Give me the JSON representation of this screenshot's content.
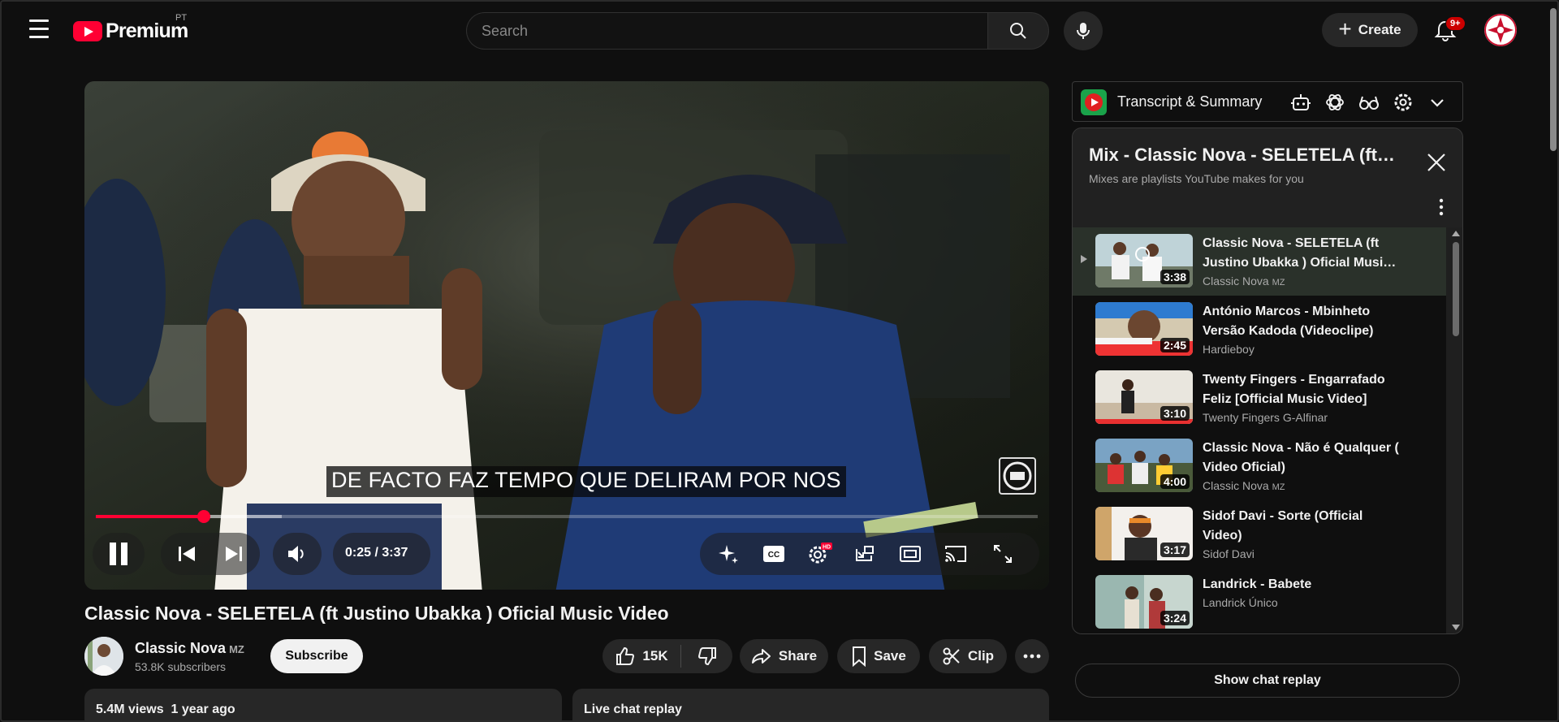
{
  "header": {
    "logo_text": "Premium",
    "country_code": "PT",
    "search_placeholder": "Search",
    "create_label": "Create",
    "notification_count": "9+"
  },
  "player": {
    "subtitle": "DE FACTO FAZ TEMPO QUE DELIRAM POR NOS",
    "current_time": "0:25",
    "separator": " / ",
    "duration": "3:37",
    "progress_fraction": 0.115,
    "buffered_fraction": 0.197
  },
  "video": {
    "title": "Classic Nova - SELETELA (ft Justino Ubakka ) Oficial Music Video",
    "channel": "Classic Nova",
    "channel_badge": "MZ",
    "subscribers": "53.8K subscribers",
    "subscribe_label": "Subscribe",
    "likes": "15K",
    "share_label": "Share",
    "save_label": "Save",
    "clip_label": "Clip"
  },
  "description": {
    "views_date": "5.4M views  1 year ago"
  },
  "live_chat": {
    "label": "Live chat replay"
  },
  "transcript_bar": {
    "title": "Transcript & Summary"
  },
  "mix": {
    "title": "Mix - Classic Nova - SELETELA (ft Justino Ubakka ) Oficial Music Video",
    "subtitle": "Mixes are playlists YouTube makes for you",
    "items": [
      {
        "title": "Classic Nova - SELETELA (ft Justino Ubakka ) Oficial Musi…",
        "channel": "Classic Nova",
        "badge": "MZ",
        "duration": "3:38"
      },
      {
        "title": "António Marcos - Mbinheto Versão Kadoda (Videoclipe)",
        "channel": "Hardieboy",
        "badge": "",
        "duration": "2:45"
      },
      {
        "title": "Twenty Fingers - Engarrafado Feliz [Official Music Video]",
        "channel": "Twenty Fingers G-Alfinar",
        "badge": "",
        "duration": "3:10"
      },
      {
        "title": "Classic Nova - Não é Qualquer ( Video Oficial)",
        "channel": "Classic Nova",
        "badge": "MZ",
        "duration": "4:00"
      },
      {
        "title": "Sidof Davi - Sorte (Official Video)",
        "channel": "Sidof Davi",
        "badge": "",
        "duration": "3:17"
      },
      {
        "title": "Landrick - Babete",
        "channel": "Landrick Único",
        "badge": "",
        "duration": "3:24"
      }
    ]
  },
  "show_chat_label": "Show chat replay",
  "colors": {
    "background": "#0f0f0f",
    "accent_red": "#ff0033",
    "surface": "#272727",
    "text_primary": "#f1f1f1",
    "text_secondary": "#aaaaaa"
  }
}
